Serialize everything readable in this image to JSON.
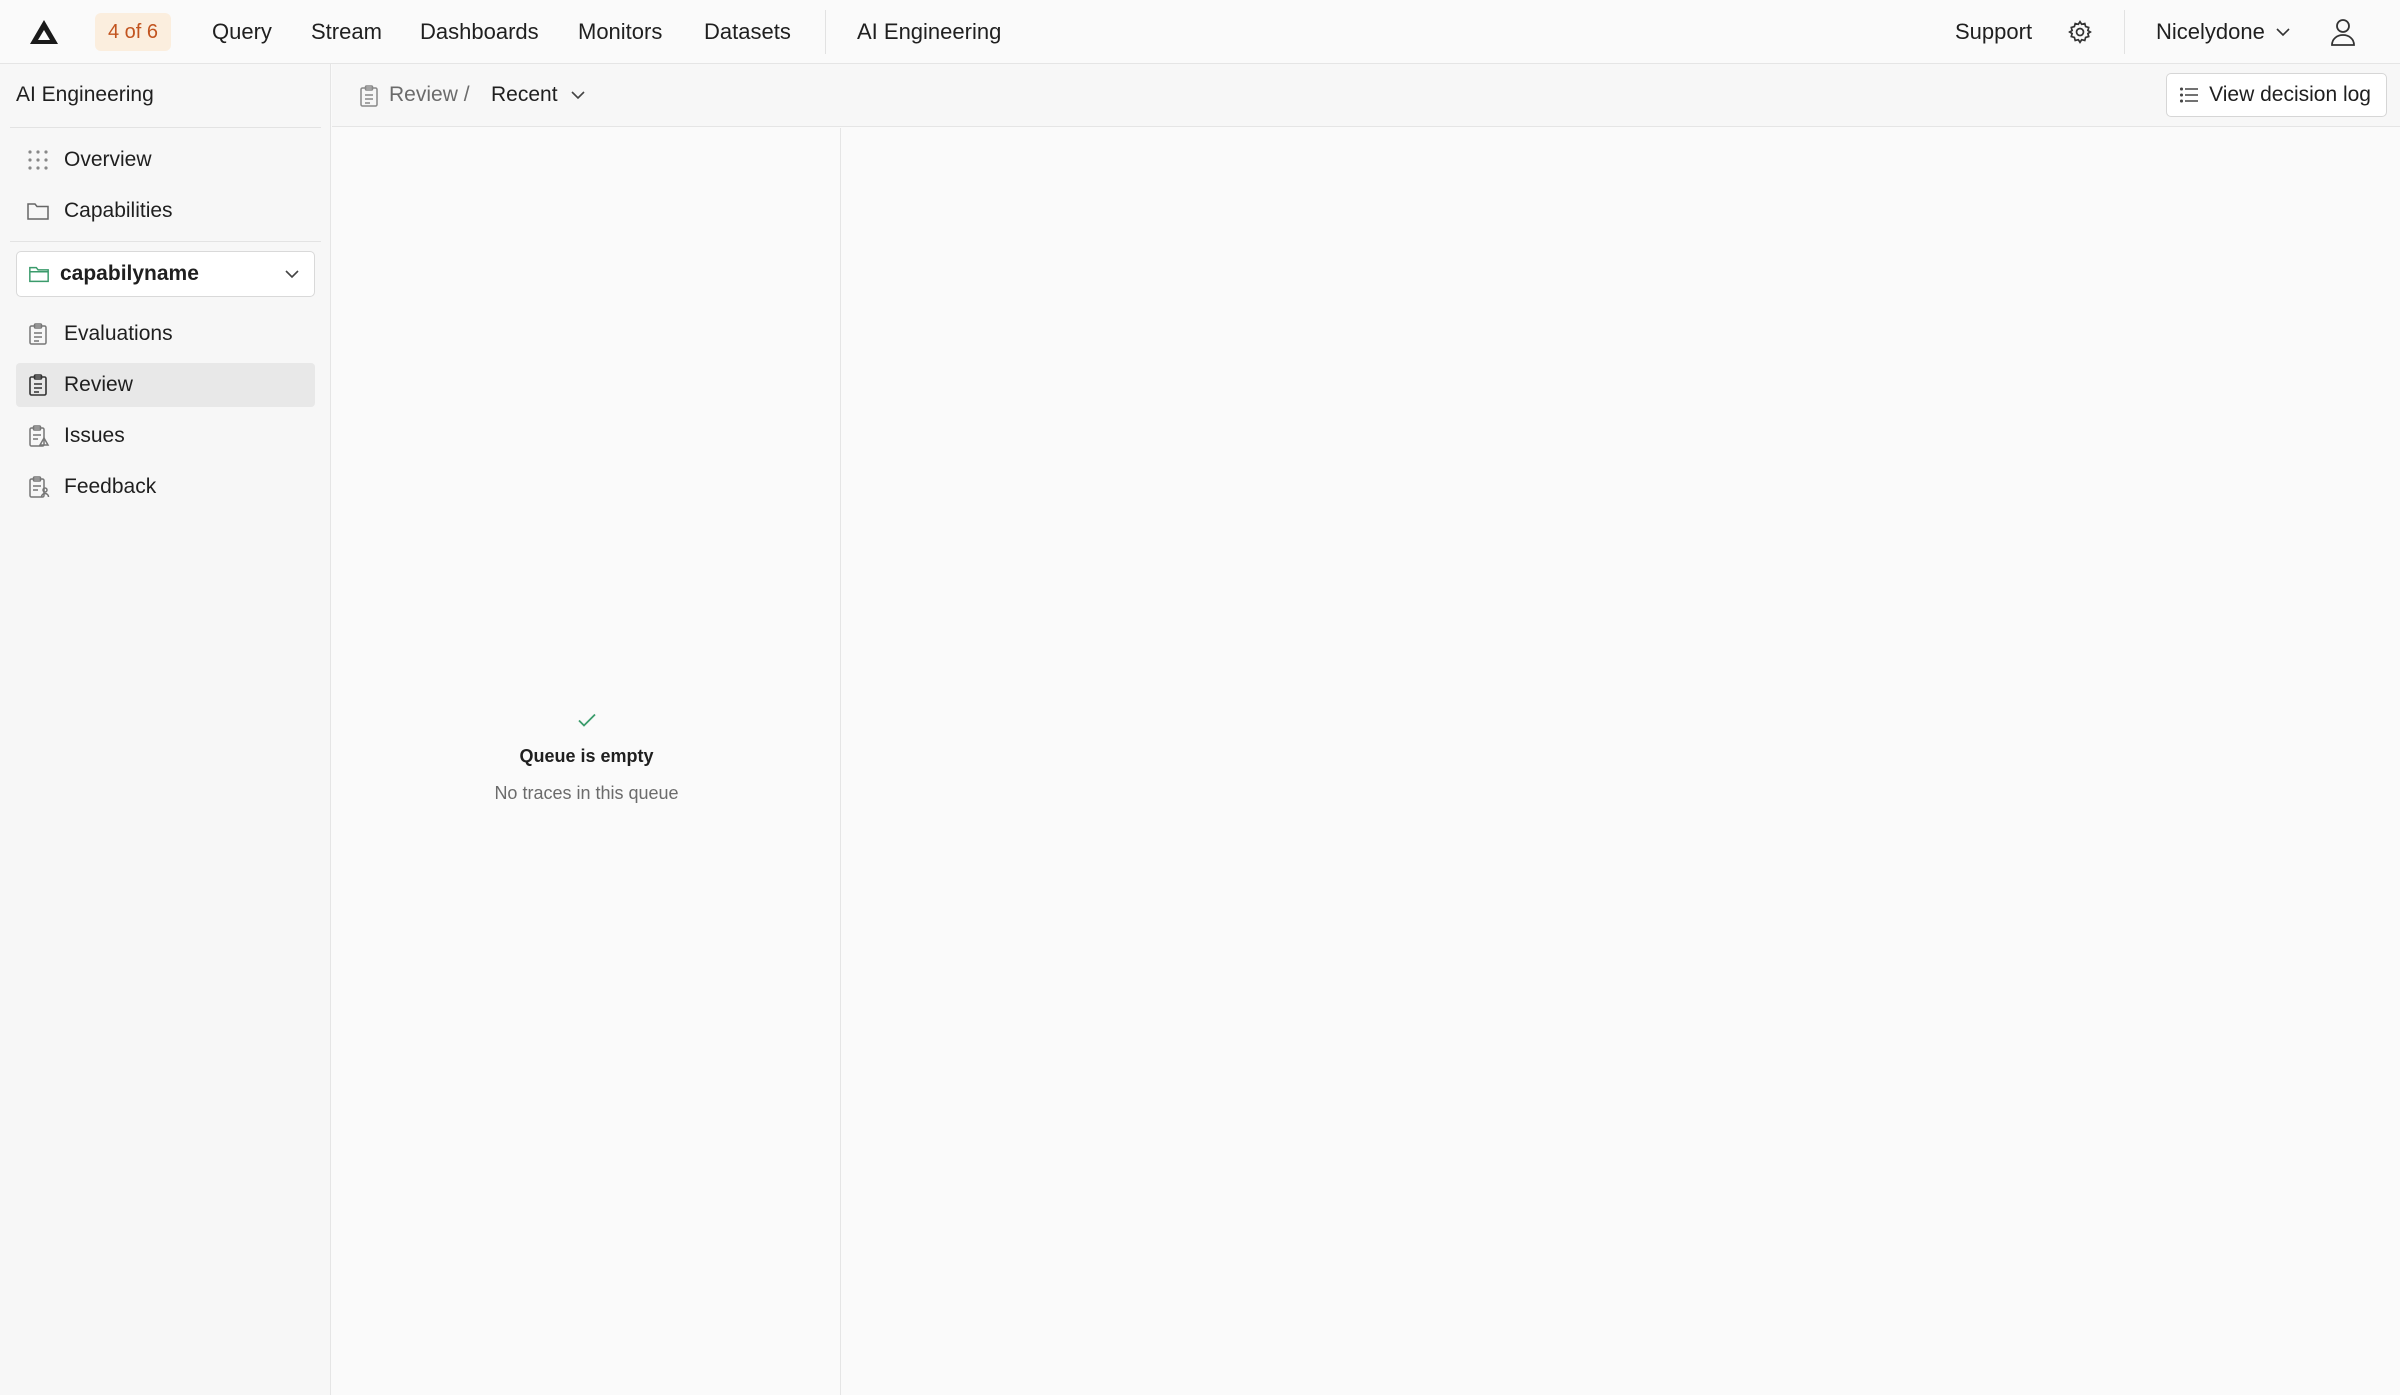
{
  "topbar": {
    "step_badge": "4 of 6",
    "nav": [
      "Query",
      "Stream",
      "Dashboards",
      "Monitors",
      "Datasets"
    ],
    "section": "AI Engineering",
    "support": "Support",
    "org": "Nicelydone",
    "icons": [
      "logo-icon",
      "gear-icon",
      "chevron-down-icon",
      "user-icon"
    ]
  },
  "sidebar": {
    "title": "AI Engineering",
    "top_items": [
      {
        "label": "Overview",
        "icon": "grid-dots-icon"
      },
      {
        "label": "Capabilities",
        "icon": "folder-icon"
      }
    ],
    "capability_select": {
      "value": "capabilyname",
      "icon": "folder-icon"
    },
    "items": [
      {
        "label": "Evaluations",
        "icon": "clipboard-icon"
      },
      {
        "label": "Review",
        "icon": "clipboard-icon",
        "active": true
      },
      {
        "label": "Issues",
        "icon": "clipboard-warning-icon"
      },
      {
        "label": "Feedback",
        "icon": "clipboard-user-icon"
      }
    ]
  },
  "subheader": {
    "breadcrumb_review": "Review /",
    "view_selector": "Recent",
    "decision_log_button": "View decision log"
  },
  "queue": {
    "empty_title": "Queue is empty",
    "empty_subtitle": "No traces in this queue"
  },
  "colors": {
    "badge_bg": "#fbeede",
    "badge_text": "#c2541f",
    "accent_green": "#3a9b6b",
    "active_item_bg": "#e8e8e8"
  }
}
